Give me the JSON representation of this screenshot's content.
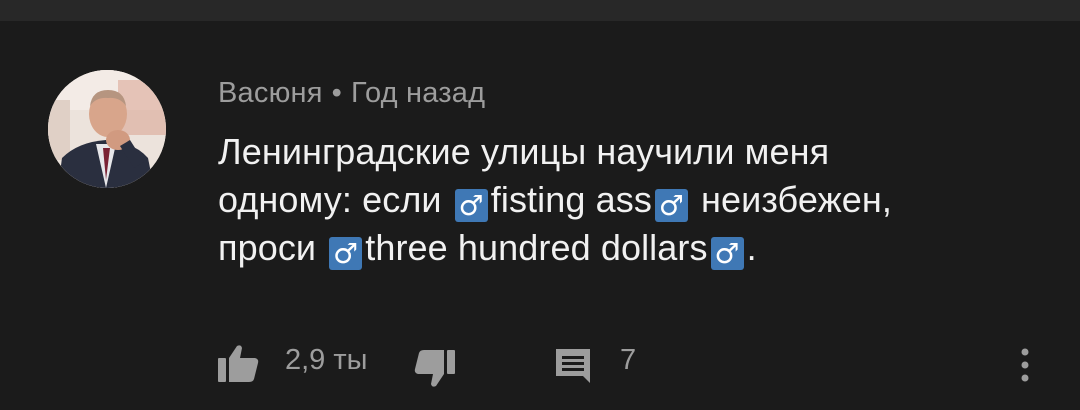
{
  "comment": {
    "author": "Васюня",
    "separator": "•",
    "time": "Год назад",
    "text_lines": [
      [
        "Ленинградские улицы научили меня"
      ],
      [
        "одному: если ",
        "♂",
        "fisting ass",
        "♂",
        " неизбежен,"
      ],
      [
        "проси ",
        "♂",
        "three hundred dollars",
        "♂",
        "."
      ]
    ],
    "likes": "2,9 ты",
    "replies": "7"
  },
  "icons": {
    "like": "thumbs-up-icon",
    "dislike": "thumbs-down-icon",
    "reply": "comment-icon",
    "more": "more-vertical-icon",
    "emoji": "male-sign-emoji"
  },
  "colors": {
    "background": "#1b1b1b",
    "top_bar": "#282828",
    "text": "#f1f1f1",
    "secondary_text": "#9d9d9d",
    "emoji_bg": "#3f78b5"
  }
}
